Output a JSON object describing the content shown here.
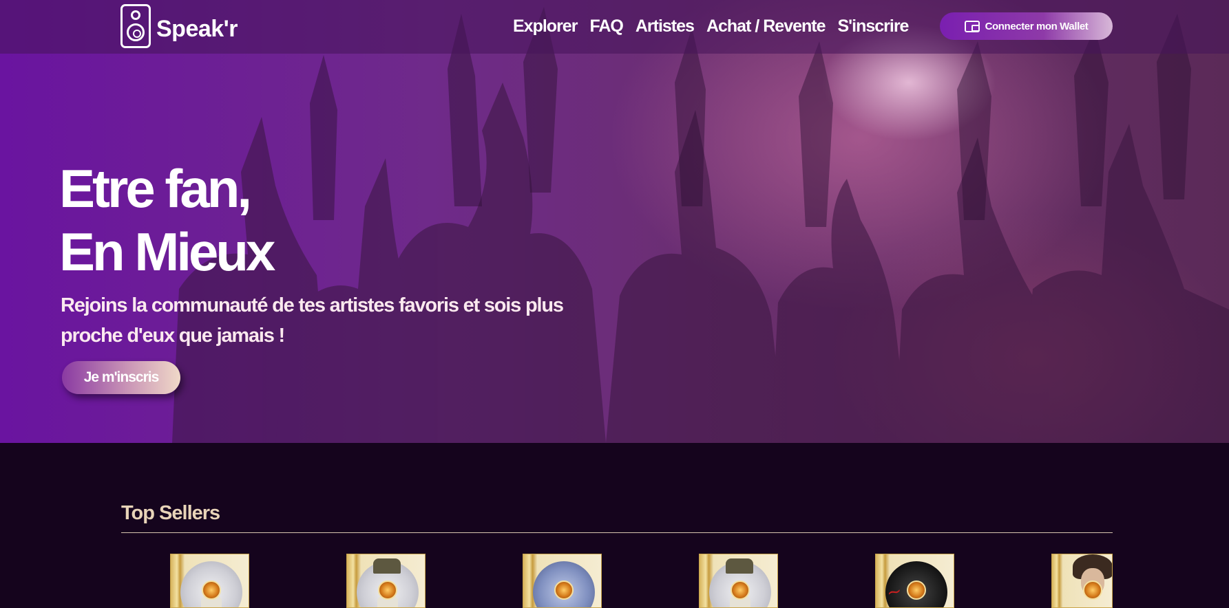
{
  "brand": {
    "name": "Speak'r"
  },
  "nav": {
    "items": [
      "Explorer",
      "FAQ",
      "Artistes",
      "Achat / Revente",
      "S'inscrire"
    ],
    "wallet_button": "Connecter mon Wallet"
  },
  "hero": {
    "title_line1": "Etre fan,",
    "title_line2": "En Mieux",
    "subtitle": "Rejoins la communauté de tes artistes favoris et sois plus proche d'eux que jamais !",
    "cta": "Je m'inscris"
  },
  "sellers": {
    "title": "Top Sellers",
    "cards": [
      {
        "art": "astronaut"
      },
      {
        "art": "cat-hat"
      },
      {
        "art": "tiara-figure"
      },
      {
        "art": "cat-hat"
      },
      {
        "art": "red-script"
      },
      {
        "art": "curly-man"
      }
    ]
  },
  "colors": {
    "accent": "#7a1fb0",
    "gold_text": "#e8d4b8",
    "dark_bg": "#15041d"
  }
}
